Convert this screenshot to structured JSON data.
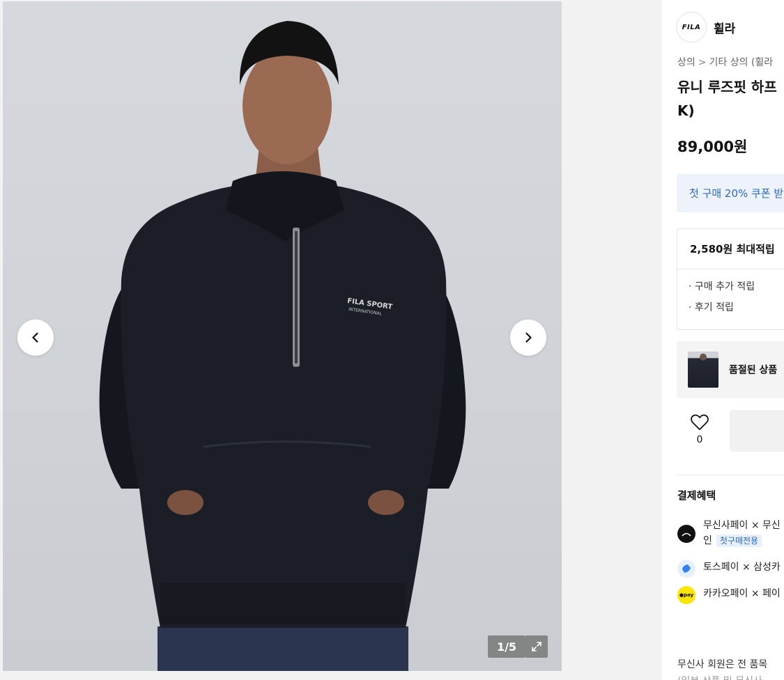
{
  "gallery": {
    "counter": "1/5",
    "prev_icon": "chevron-left-icon",
    "next_icon": "chevron-right-icon",
    "expand_icon": "expand-icon",
    "chest_logo": [
      "FILA SPORT",
      "INTERNATIONAL"
    ]
  },
  "brand": {
    "logo_text": "FILA",
    "name": "휠라"
  },
  "breadcrumb": {
    "items": [
      "상의",
      "기타 상의 (휠라"
    ]
  },
  "product": {
    "title_line1": "유니 루즈핏 하프",
    "title_line2": "K)",
    "price": "89,000원"
  },
  "coupon": {
    "text": "첫 구매 20% 쿠폰 받"
  },
  "points": {
    "header": "2,580원 최대적립",
    "items": [
      "· 구매 추가 적립",
      "· 후기 적립"
    ]
  },
  "soldout": {
    "text": "품절된 상품"
  },
  "like": {
    "icon": "heart-icon",
    "count": "0"
  },
  "payment": {
    "title": "결제혜택",
    "rows": [
      {
        "name": "무신사페이 × 무신",
        "line2": "인",
        "badge": "첫구매전용",
        "icon": "musinsa-pay-icon",
        "color": "#111111"
      },
      {
        "name": "토스페이 × 삼성카",
        "icon": "toss-pay-icon",
        "color": "#3182f6"
      },
      {
        "name": "카카오페이 × 페이",
        "icon": "kakao-pay-icon",
        "color": "#fee500",
        "icon_text": "●pay"
      }
    ]
  },
  "member_note": "무신사 회원은 전 품목",
  "member_note_2": "(일부 상품 및 무신사"
}
